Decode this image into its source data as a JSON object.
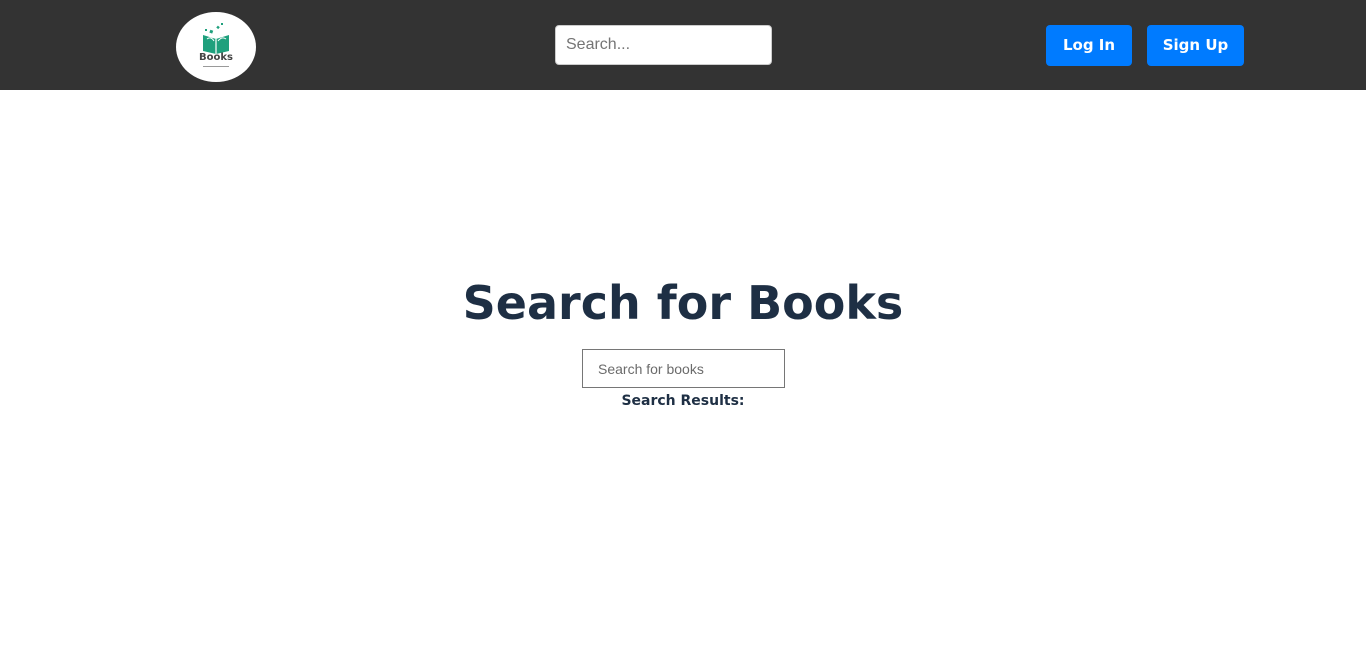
{
  "header": {
    "logo": {
      "text": "Books",
      "icon": "open-book-leaves-icon",
      "colors": {
        "primary": "#1fa07d",
        "text": "#444444"
      }
    },
    "search": {
      "placeholder": "Search...",
      "value": ""
    },
    "buttons": {
      "login_label": "Log In",
      "signup_label": "Sign Up"
    },
    "colors": {
      "background": "#333333",
      "button": "#007bff"
    }
  },
  "main": {
    "title": "Search for Books",
    "search": {
      "placeholder": "Search for books",
      "value": ""
    },
    "results_label": "Search Results:",
    "colors": {
      "title": "#1e2f44"
    }
  }
}
